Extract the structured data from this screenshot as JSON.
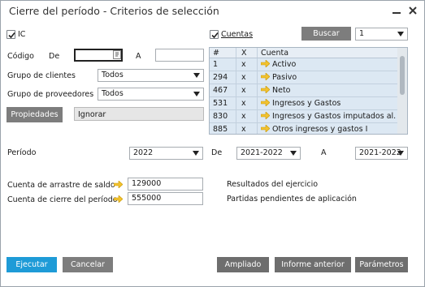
{
  "window": {
    "title": "Cierre del período - Criterios de selección"
  },
  "left": {
    "ic_label": "IC",
    "codigo_label": "Código",
    "de_label": "De",
    "a_label": "A",
    "codigo_from": "",
    "codigo_to": "",
    "grupo_clientes_label": "Grupo de clientes",
    "grupo_clientes_value": "Todos",
    "grupo_proveedores_label": "Grupo de proveedores",
    "grupo_proveedores_value": "Todos",
    "propiedades_label": "Propiedades",
    "ignorar_label": "Ignorar"
  },
  "right": {
    "cuentas_label": "Cuentas",
    "buscar_label": "Buscar",
    "buscar_select_value": "1",
    "table": {
      "headers": [
        "#",
        "X",
        "Cuenta"
      ],
      "rows": [
        {
          "num": "1",
          "x": "x",
          "cuenta": "Activo"
        },
        {
          "num": "294",
          "x": "x",
          "cuenta": "Pasivo"
        },
        {
          "num": "467",
          "x": "x",
          "cuenta": "Neto"
        },
        {
          "num": "531",
          "x": "x",
          "cuenta": "Ingresos y Gastos"
        },
        {
          "num": "830",
          "x": "x",
          "cuenta": "Ingresos y Gastos imputados al..."
        },
        {
          "num": "885",
          "x": "x",
          "cuenta": "Otros ingresos y gastos I"
        }
      ]
    }
  },
  "periodo": {
    "label": "Período",
    "value": "2022",
    "de_label": "De",
    "de_value": "2021-2022",
    "a_label": "A",
    "a_value": "2021-2022"
  },
  "cuentas": {
    "arrastre_label": "Cuenta de arrastre de saldo",
    "arrastre_value": "129000",
    "arrastre_desc": "Resultados del ejercicio",
    "cierre_label": "Cuenta de cierre del período",
    "cierre_value": "555000",
    "cierre_desc": "Partidas pendientes de aplicación"
  },
  "buttons": {
    "ejecutar": "Ejecutar",
    "cancelar": "Cancelar",
    "ampliado": "Ampliado",
    "informe_anterior": "Informe anterior",
    "parametros": "Parámetros"
  },
  "colors": {
    "accent": "#1e9bd7",
    "link_arrow": "#f2c230",
    "table_bg": "#dce8f3"
  }
}
